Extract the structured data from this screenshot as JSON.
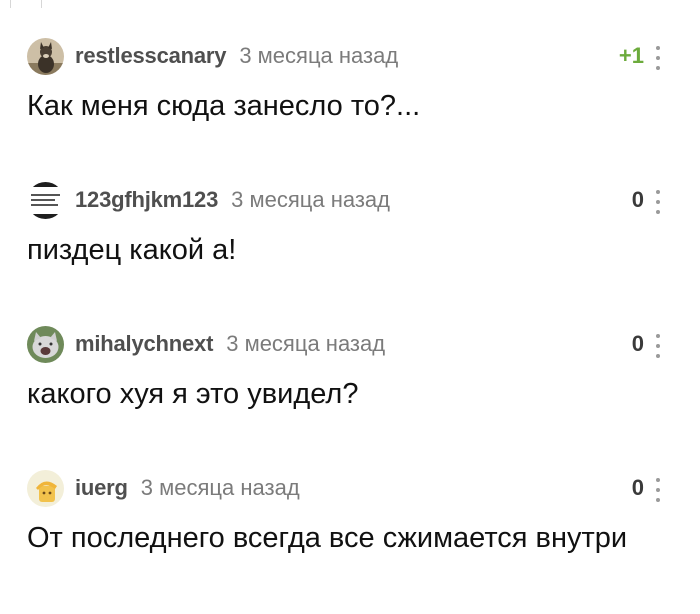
{
  "comments": [
    {
      "username": "restlesscanary",
      "time": "3 месяца назад",
      "score": "+1",
      "text": "Как меня сюда занесло то?...",
      "avatar_icon": "dog-avatar-icon"
    },
    {
      "username": "123gfhjkm123",
      "time": "3 месяца назад",
      "score": "0",
      "text": "пиздец какой а!",
      "avatar_icon": "text-screenshot-avatar-icon"
    },
    {
      "username": "mihalychnext",
      "time": "3 месяца назад",
      "score": "0",
      "text": "какого хуя я это увидел?",
      "avatar_icon": "cat-avatar-icon"
    },
    {
      "username": "iuerg",
      "time": "3 месяца назад",
      "score": "0",
      "text": "От последнего всегда все сжимается внутри",
      "avatar_icon": "cartoon-avatar-icon"
    }
  ],
  "colors": {
    "username": "#4f4f4f",
    "time": "#7b7b7b",
    "score_positive": "#6cab3c",
    "score_neutral": "#3a3a3a",
    "text": "#111111"
  }
}
